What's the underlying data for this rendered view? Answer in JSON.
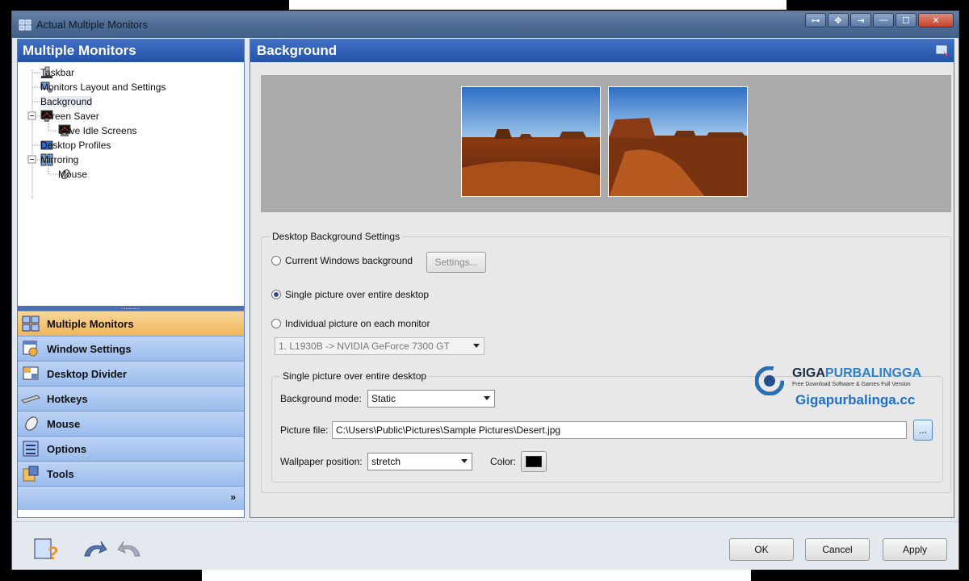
{
  "window": {
    "title": "Actual Multiple Monitors"
  },
  "sidebar": {
    "title": "Multiple Monitors",
    "tree": [
      {
        "label": "Taskbar"
      },
      {
        "label": "Monitors Layout and Settings"
      },
      {
        "label": "Background"
      },
      {
        "label": "Screen Saver"
      },
      {
        "label": "Save Idle Screens"
      },
      {
        "label": "Desktop Profiles"
      },
      {
        "label": "Mirroring"
      },
      {
        "label": "Mouse"
      }
    ],
    "splitter_label": "..........",
    "nav": [
      {
        "label": "Multiple Monitors"
      },
      {
        "label": "Window Settings"
      },
      {
        "label": "Desktop Divider"
      },
      {
        "label": "Hotkeys"
      },
      {
        "label": "Mouse"
      },
      {
        "label": "Options"
      },
      {
        "label": "Tools"
      }
    ],
    "more_label": "»"
  },
  "main": {
    "title": "Background",
    "settings_group": "Desktop Background Settings",
    "radio_current": "Current Windows background",
    "settings_button": "Settings...",
    "radio_single": "Single picture over entire desktop",
    "radio_individual": "Individual picture on each monitor",
    "monitor_select": "1. L1930B -> NVIDIA GeForce 7300 GT",
    "single_group": "Single picture over entire desktop",
    "bg_mode_label": "Background mode:",
    "bg_mode_value": "Static",
    "picture_file_label": "Picture file:",
    "picture_file_value": "C:\\Users\\Public\\Pictures\\Sample Pictures\\Desert.jpg",
    "browse_label": "...",
    "wallpaper_pos_label": "Wallpaper position:",
    "wallpaper_pos_value": "stretch",
    "color_label": "Color:",
    "color_value": "#000000"
  },
  "watermark": {
    "brand_a": "GIGA",
    "brand_b": "PURBALINGGA",
    "tagline": "Free Download Software & Games Full Version",
    "site": "Gigapurbalinga.cc"
  },
  "footer": {
    "ok": "OK",
    "cancel": "Cancel",
    "apply": "Apply"
  },
  "colors": {
    "header_blue": "#2553a8",
    "active_nav": "#f0b55a",
    "nav_blue": "#9bbcec"
  }
}
